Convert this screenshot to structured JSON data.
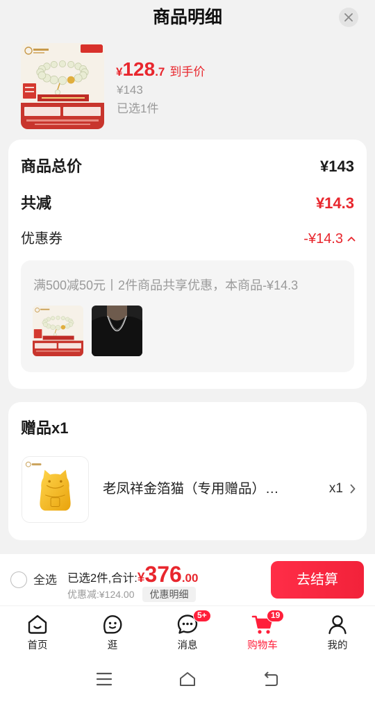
{
  "sheet": {
    "title": "商品明细"
  },
  "product": {
    "price_currency": "¥",
    "price_integer": "128",
    "price_decimal": ".7",
    "price_tag": "到手价",
    "original_price": "¥143",
    "selected_count": "已选1件"
  },
  "summary": {
    "total_label": "商品总价",
    "total_value": "¥143",
    "discount_label": "共减",
    "discount_value": "¥14.3",
    "coupon_label": "优惠券",
    "coupon_value": "-¥14.3",
    "coupon_detail": "满500减50元丨2件商品共享优惠，本商品-¥14.3"
  },
  "gift": {
    "header": "赠品x1",
    "name": "老凤祥金箔猫（专用赠品）…",
    "quantity": "x1"
  },
  "checkout": {
    "select_all": "全选",
    "selected_summary": "已选2件,合计:",
    "total_currency": "¥",
    "total_integer": "376",
    "total_decimal": ".00",
    "saved": "优惠减:¥124.00",
    "detail_button": "优惠明细",
    "checkout_button": "去结算"
  },
  "tabs": [
    {
      "label": "首页",
      "icon": "home-icon"
    },
    {
      "label": "逛",
      "icon": "browse-icon"
    },
    {
      "label": "消息",
      "icon": "message-icon",
      "badge": "5+"
    },
    {
      "label": "购物车",
      "icon": "cart-icon",
      "badge": "19",
      "active": true
    },
    {
      "label": "我的",
      "icon": "profile-icon"
    }
  ],
  "system_nav": [
    {
      "icon": "menu-icon"
    },
    {
      "icon": "home-outline-icon"
    },
    {
      "icon": "back-icon"
    }
  ],
  "colors": {
    "accent": "#e8262d",
    "checkout_button": "#f2223a",
    "background": "#f2f2f2",
    "muted": "#999999",
    "text": "#1a1a1a"
  }
}
